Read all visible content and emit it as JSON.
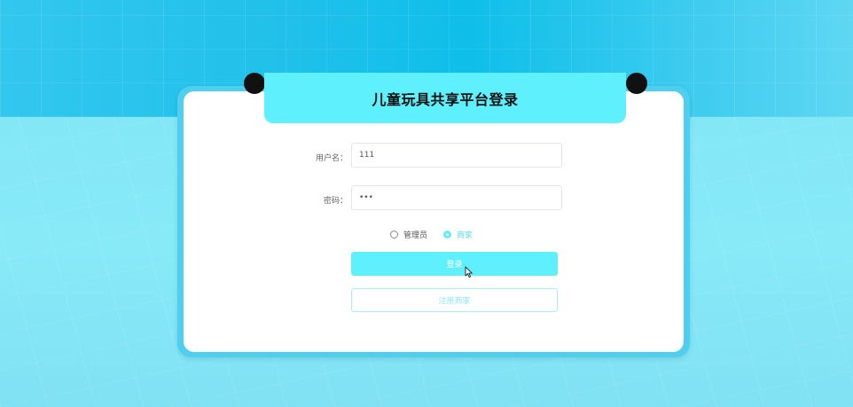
{
  "page": {
    "title": "儿童玩具共享平台登录"
  },
  "form": {
    "username": {
      "label": "用户名：",
      "value": "111"
    },
    "password": {
      "label": "密码：",
      "value": "•••"
    },
    "roles": [
      {
        "label": "管理员",
        "checked": false
      },
      {
        "label": "商家",
        "checked": true
      }
    ],
    "login_label": "登录",
    "register_label": "注册商家"
  },
  "colors": {
    "accent": "#5ff0fd",
    "frame": "#4fcff0",
    "background": "#7fe3f6"
  }
}
